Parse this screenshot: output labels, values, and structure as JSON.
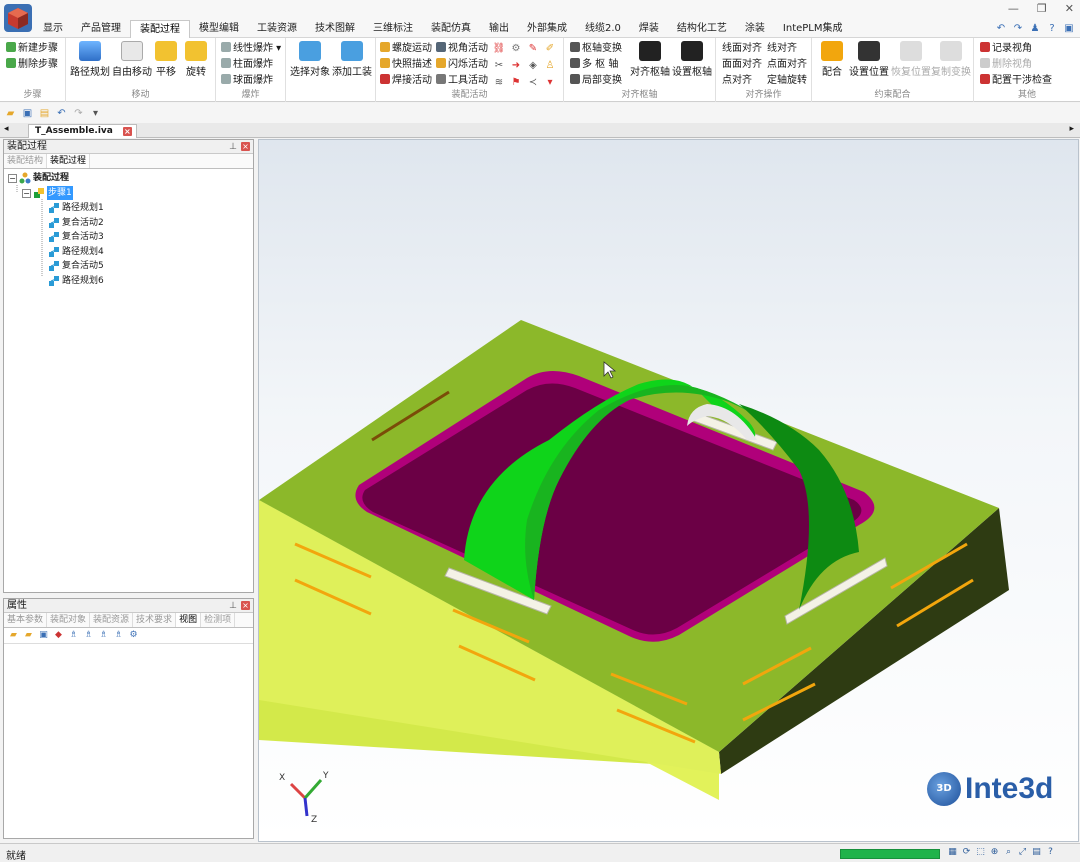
{
  "menu": {
    "tabs": [
      "显示",
      "产品管理",
      "装配过程",
      "模型编辑",
      "工装资源",
      "技术图解",
      "三维标注",
      "装配仿真",
      "输出",
      "外部集成",
      "线缆2.0",
      "焊装",
      "结构化工艺",
      "涂装",
      "IntePLM集成"
    ],
    "active_index": 2
  },
  "ribbon": {
    "steps": {
      "caption": "步骤",
      "new": "新建步骤",
      "delete": "删除步骤"
    },
    "move": {
      "caption": "移动",
      "path": "路径规划",
      "free": "自由移动",
      "translate": "平移",
      "rotate": "旋转"
    },
    "explode": {
      "caption": "爆炸",
      "linear": "线性爆炸",
      "cylinder": "柱面爆炸",
      "sphere": "球面爆炸"
    },
    "select": {
      "object": "选择对象",
      "add_tool": "添加工装"
    },
    "activity": {
      "caption": "装配活动",
      "screw": "螺旋运动",
      "view": "视角活动",
      "snapshot": "快照描述",
      "flash": "闪烁活动",
      "weld": "焊接活动",
      "tool": "工具活动"
    },
    "pivot": {
      "caption": "对齐枢轴",
      "transform": "枢轴变换",
      "multi": "多 枢 轴",
      "local": "局部变换",
      "align_pivot": "对齐枢轴",
      "set_pivot": "设置枢轴"
    },
    "align": {
      "caption": "对齐操作",
      "face_face": "线面对齐",
      "line_line": "线对齐",
      "plane_plane": "面面对齐",
      "point_plane": "点面对齐",
      "point": "点对齐",
      "axis_rotate": "定轴旋转"
    },
    "constraint": {
      "caption": "约束配合",
      "mate": "配合",
      "set_pos": "设置位置",
      "restore": "恢复位置",
      "copy": "复制变换"
    },
    "other": {
      "caption": "其他",
      "record": "记录视角",
      "delete_view": "删除视角",
      "interference": "配置干涉检查"
    }
  },
  "document": {
    "tab": "T_Assemble.iva"
  },
  "assembly_panel": {
    "title": "装配过程",
    "tabs": [
      "装配结构",
      "装配过程"
    ],
    "active_tab": 1,
    "root": "装配过程",
    "step": "步骤1",
    "items": [
      "路径规划1",
      "复合活动2",
      "复合活动3",
      "路径规划4",
      "复合活动5",
      "路径规划6"
    ]
  },
  "properties_panel": {
    "title": "属性",
    "tabs": [
      "基本参数",
      "装配对象",
      "装配资源",
      "技术要求",
      "视图",
      "检测项"
    ],
    "active_tab": 4
  },
  "viewport": {
    "logo_text": "Inte3d",
    "axis_labels": [
      "X",
      "Y",
      "Z"
    ],
    "colors": {
      "plate": "#8cb82a",
      "plate_side": "#2e3b12",
      "pocket": "#6b0045",
      "pocket_rim": "#b0007a",
      "bracket": "#17d21a",
      "slot": "#f2a60d"
    }
  },
  "status": {
    "text": "就绪",
    "progress": 1.0
  }
}
